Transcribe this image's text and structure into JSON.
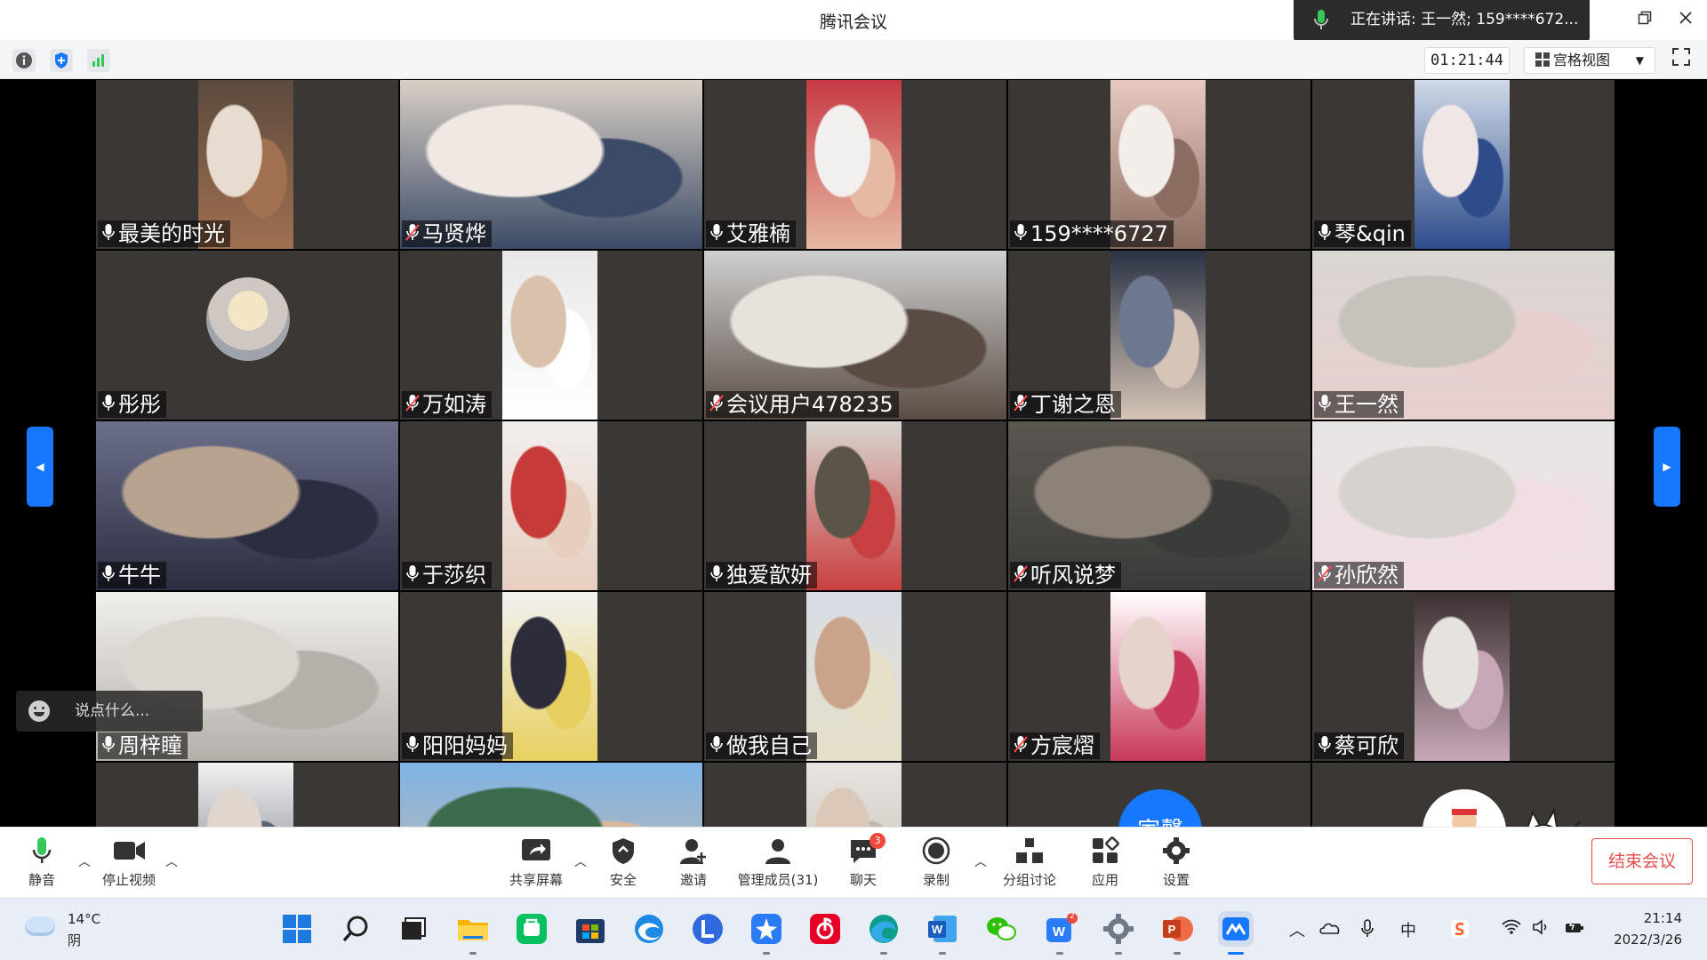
{
  "window": {
    "title": "腾讯会议",
    "speaking": "正在讲话: 王一然; 159****672...",
    "restore_icon": "restore-icon",
    "close_icon": "close-icon"
  },
  "infobar": {
    "timer": "01:21:44",
    "view_mode": "宫格视图"
  },
  "participants": [
    {
      "name": "最美的时光",
      "muted": false,
      "video": "narrow",
      "colors": [
        "#5c4a3d",
        "#e8dcd0",
        "#a07050"
      ]
    },
    {
      "name": "马贤烨",
      "muted": true,
      "video": "wide",
      "colors": [
        "#d9cfc6",
        "#f0e8e2",
        "#3b4a66"
      ]
    },
    {
      "name": "艾雅楠",
      "muted": false,
      "video": "narrow",
      "colors": [
        "#c63a45",
        "#f2f0ee",
        "#e6b9a5"
      ]
    },
    {
      "name": "159****6727",
      "muted": false,
      "video": "narrow",
      "colors": [
        "#e9c9c0",
        "#f4eeea",
        "#8a6c60"
      ]
    },
    {
      "name": "琴&qin",
      "muted": false,
      "video": "narrow",
      "colors": [
        "#cfd9e8",
        "#f1e6e6",
        "#2e4c8a"
      ]
    },
    {
      "name": "彤彤",
      "muted": false,
      "video": "avatar",
      "colors": [
        "#3a3735"
      ]
    },
    {
      "name": "万如涛",
      "muted": true,
      "video": "narrow",
      "colors": [
        "#e8e8e8",
        "#d9c2ac",
        "#ffffff"
      ]
    },
    {
      "name": "会议用户478235",
      "muted": true,
      "video": "wide",
      "colors": [
        "#cfcfcf",
        "#e6e2dc",
        "#5a4c44"
      ]
    },
    {
      "name": "丁谢之恩",
      "muted": true,
      "video": "narrow",
      "colors": [
        "#2a3344",
        "#6d7890",
        "#d6c4b6"
      ]
    },
    {
      "name": "王一然",
      "muted": false,
      "video": "wide",
      "active": true,
      "colors": [
        "#d9d6d2",
        "#c8c2bc",
        "#e8cfcf"
      ]
    },
    {
      "name": "牛牛",
      "muted": false,
      "video": "wide",
      "colors": [
        "#6b6f8a",
        "#b8a391",
        "#2b2e40"
      ]
    },
    {
      "name": "于莎织",
      "muted": false,
      "video": "narrow",
      "colors": [
        "#f1efed",
        "#c73a3a",
        "#e7cfc0"
      ]
    },
    {
      "name": "独爱歆妍",
      "muted": false,
      "video": "narrow",
      "colors": [
        "#d8d6d0",
        "#5a5548",
        "#c94040"
      ]
    },
    {
      "name": "听风说梦",
      "muted": true,
      "video": "wide",
      "colors": [
        "#5c5650",
        "#8c8278",
        "#3a3c3a"
      ]
    },
    {
      "name": "孙欣然",
      "muted": true,
      "video": "wide",
      "colors": [
        "#e8e6e4",
        "#d6d2ce",
        "#f1dde4"
      ]
    },
    {
      "name": "周梓瞳",
      "muted": false,
      "video": "wide",
      "colors": [
        "#f1efec",
        "#dcd6d0",
        "#b5b0aa"
      ]
    },
    {
      "name": "阳阳妈妈",
      "muted": false,
      "video": "narrow",
      "colors": [
        "#f2f2f2",
        "#2c2c3a",
        "#e8d060"
      ]
    },
    {
      "name": "做我自己",
      "muted": false,
      "video": "narrow",
      "colors": [
        "#d8dce6",
        "#c9a48a",
        "#e6e0c8"
      ]
    },
    {
      "name": "方宸熠",
      "muted": true,
      "video": "narrow",
      "colors": [
        "#ffffff",
        "#e6d4cc",
        "#c83a5a"
      ]
    },
    {
      "name": "蔡可欣",
      "muted": false,
      "video": "narrow",
      "colors": [
        "#3a3030",
        "#e6e2de",
        "#c8a8b8"
      ]
    },
    {
      "name": "",
      "muted": false,
      "video": "narrow",
      "colors": [
        "#f2f2f2",
        "#e0d6ce",
        "#5a6070"
      ]
    },
    {
      "name": "",
      "muted": false,
      "video": "wide",
      "colors": [
        "#7db4e6",
        "#3c6a4c",
        "#d9b8a0"
      ]
    },
    {
      "name": "",
      "muted": false,
      "video": "narrow",
      "colors": [
        "#e8e4e0",
        "#dcc8b8",
        "#bfb6ac"
      ]
    },
    {
      "name": "",
      "muted": false,
      "video": "namecircle",
      "circle_text": "家馨",
      "colors": [
        "#1677ff"
      ]
    },
    {
      "name": "",
      "muted": false,
      "video": "cartoon",
      "colors": [
        "#ffffff"
      ]
    }
  ],
  "chat": {
    "placeholder": "说点什么..."
  },
  "toolbar": {
    "mute": "静音",
    "stop_video": "停止视频",
    "share": "共享屏幕",
    "security": "安全",
    "invite": "邀请",
    "members": "管理成员(31)",
    "chat": "聊天",
    "chat_badge": "3",
    "record": "录制",
    "breakout": "分组讨论",
    "apps": "应用",
    "settings": "设置",
    "end": "结束会议"
  },
  "taskbar": {
    "temperature": "14°C",
    "condition": "阴",
    "ime": "中",
    "time": "21:14",
    "date": "2022/3/26",
    "word_badge": "2"
  },
  "colors": {
    "accent": "#1677ff",
    "end_red": "#e34d4d",
    "tile_bg": "#3a3735",
    "active_border": "#3cd26a"
  }
}
